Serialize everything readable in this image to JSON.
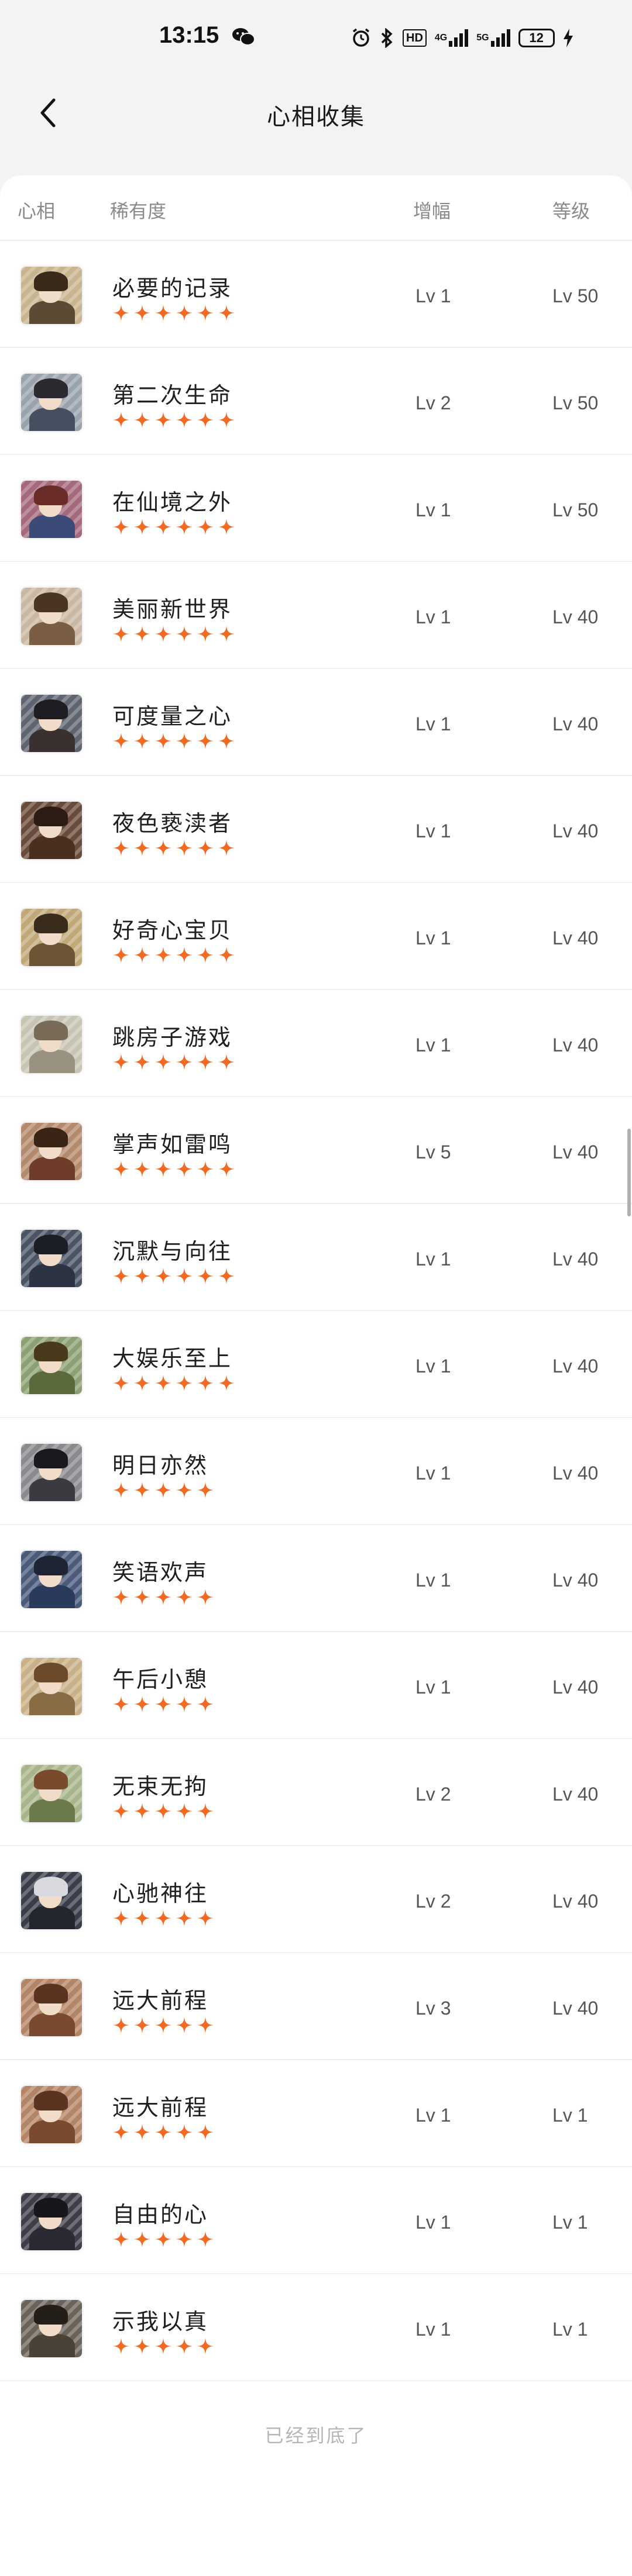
{
  "status_bar": {
    "time": "13:15",
    "network_4g": "4G",
    "network_5g": "5G",
    "hd": "HD",
    "battery": "12"
  },
  "header": {
    "title": "心相收集"
  },
  "table": {
    "headers": {
      "face": "心相",
      "rarity": "稀有度",
      "amplify": "增幅",
      "level": "等级"
    },
    "rows": [
      {
        "name": "必要的记录",
        "stars": 6,
        "amplify": "Lv 1",
        "level": "Lv 50",
        "bg": "#c8b48e",
        "hair": "#3a2a1c",
        "body": "#5b4a34"
      },
      {
        "name": "第二次生命",
        "stars": 6,
        "amplify": "Lv 2",
        "level": "Lv 50",
        "bg": "#9aa3ad",
        "hair": "#2a2a30",
        "body": "#445060"
      },
      {
        "name": "在仙境之外",
        "stars": 6,
        "amplify": "Lv 1",
        "level": "Lv 50",
        "bg": "#a4697a",
        "hair": "#6a2c28",
        "body": "#3c4a78"
      },
      {
        "name": "美丽新世界",
        "stars": 6,
        "amplify": "Lv 1",
        "level": "Lv 40",
        "bg": "#c9b7a2",
        "hair": "#4a3424",
        "body": "#7a5e44"
      },
      {
        "name": "可度量之心",
        "stars": 6,
        "amplify": "Lv 1",
        "level": "Lv 40",
        "bg": "#5e6470",
        "hair": "#1e1e22",
        "body": "#3a3030"
      },
      {
        "name": "夜色亵渎者",
        "stars": 6,
        "amplify": "Lv 1",
        "level": "Lv 40",
        "bg": "#6a4a3a",
        "hair": "#2c1c14",
        "body": "#4a2e20"
      },
      {
        "name": "好奇心宝贝",
        "stars": 6,
        "amplify": "Lv 1",
        "level": "Lv 40",
        "bg": "#c2a878",
        "hair": "#3a2c1c",
        "body": "#6c5434"
      },
      {
        "name": "跳房子游戏",
        "stars": 6,
        "amplify": "Lv 1",
        "level": "Lv 40",
        "bg": "#c8c4b4",
        "hair": "#7a6a58",
        "body": "#9a9280"
      },
      {
        "name": "掌声如雷鸣",
        "stars": 6,
        "amplify": "Lv 5",
        "level": "Lv 40",
        "bg": "#b48a6e",
        "hair": "#3a2416",
        "body": "#6e3c28"
      },
      {
        "name": "沉默与向往",
        "stars": 6,
        "amplify": "Lv 1",
        "level": "Lv 40",
        "bg": "#4a5464",
        "hair": "#1c1e26",
        "body": "#2c3444"
      },
      {
        "name": "大娱乐至上",
        "stars": 6,
        "amplify": "Lv 1",
        "level": "Lv 40",
        "bg": "#8ca074",
        "hair": "#4a3a1c",
        "body": "#5a6a3a"
      },
      {
        "name": "明日亦然",
        "stars": 5,
        "amplify": "Lv 1",
        "level": "Lv 40",
        "bg": "#8a8a8e",
        "hair": "#1a1a1e",
        "body": "#3a3a40"
      },
      {
        "name": "笑语欢声",
        "stars": 5,
        "amplify": "Lv 1",
        "level": "Lv 40",
        "bg": "#4a5a7a",
        "hair": "#1e2434",
        "body": "#2a3a5c"
      },
      {
        "name": "午后小憩",
        "stars": 5,
        "amplify": "Lv 1",
        "level": "Lv 40",
        "bg": "#c8b088",
        "hair": "#6a4a28",
        "body": "#8a6c44"
      },
      {
        "name": "无束无拘",
        "stars": 5,
        "amplify": "Lv 2",
        "level": "Lv 40",
        "bg": "#a8b48a",
        "hair": "#7a4a2c",
        "body": "#6a7a4a"
      },
      {
        "name": "心驰神往",
        "stars": 5,
        "amplify": "Lv 2",
        "level": "Lv 40",
        "bg": "#3a3e4a",
        "hair": "#d8d8de",
        "body": "#24262e"
      },
      {
        "name": "远大前程",
        "stars": 5,
        "amplify": "Lv 3",
        "level": "Lv 40",
        "bg": "#b48466",
        "hair": "#5a3420",
        "body": "#7a4a30"
      },
      {
        "name": "远大前程",
        "stars": 5,
        "amplify": "Lv 1",
        "level": "Lv 1",
        "bg": "#b48466",
        "hair": "#5a3420",
        "body": "#7a4a30"
      },
      {
        "name": "自由的心",
        "stars": 5,
        "amplify": "Lv 1",
        "level": "Lv 1",
        "bg": "#3e3e48",
        "hair": "#16161c",
        "body": "#2a2a34"
      },
      {
        "name": "示我以真",
        "stars": 5,
        "amplify": "Lv 1",
        "level": "Lv 1",
        "bg": "#6a6458",
        "hair": "#241e18",
        "body": "#4a4236"
      }
    ]
  },
  "footer": {
    "end_text": "已经到底了"
  },
  "colors": {
    "star": "#f26a22",
    "accent": "#f26a22"
  }
}
